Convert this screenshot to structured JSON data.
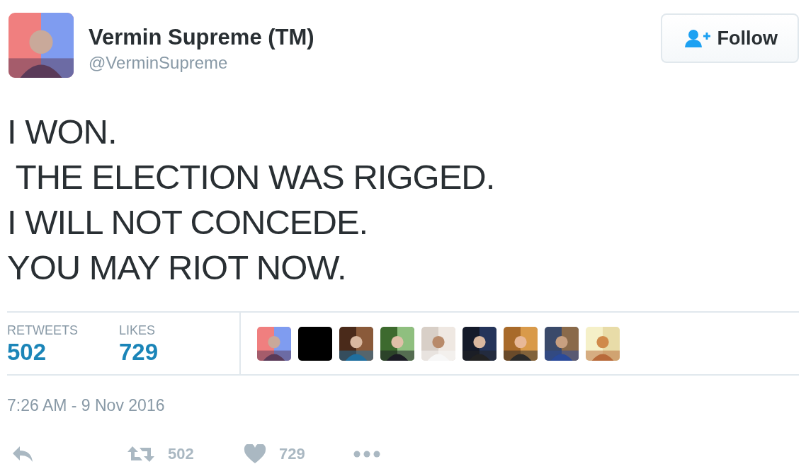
{
  "author": {
    "avatar": {
      "kind": "picture"
    },
    "name": "Vermin Supreme (TM)",
    "handle": "@VerminSupreme"
  },
  "follow_button": {
    "label": "Follow"
  },
  "tweet_text": [
    "I WON.",
    " THE ELECTION WAS RIGGED.",
    "I WILL NOT CONCEDE.",
    "YOU MAY RIOT NOW."
  ],
  "stats": [
    {
      "label": "RETWEETS",
      "value": "502"
    },
    {
      "label": "LIKES",
      "value": "729"
    }
  ],
  "likers": [
    {
      "kind": "picture"
    },
    {
      "kind": "blank"
    },
    {
      "kind": "picture"
    },
    {
      "kind": "picture"
    },
    {
      "kind": "picture"
    },
    {
      "kind": "picture"
    },
    {
      "kind": "picture"
    },
    {
      "kind": "picture"
    },
    {
      "kind": "picture"
    }
  ],
  "timestamp": "7:26 AM - 9 Nov 2016",
  "actions": [
    {
      "kind": "reply"
    },
    {
      "kind": "retweet",
      "count": "502"
    },
    {
      "kind": "like",
      "count": "729"
    },
    {
      "kind": "more"
    }
  ]
}
